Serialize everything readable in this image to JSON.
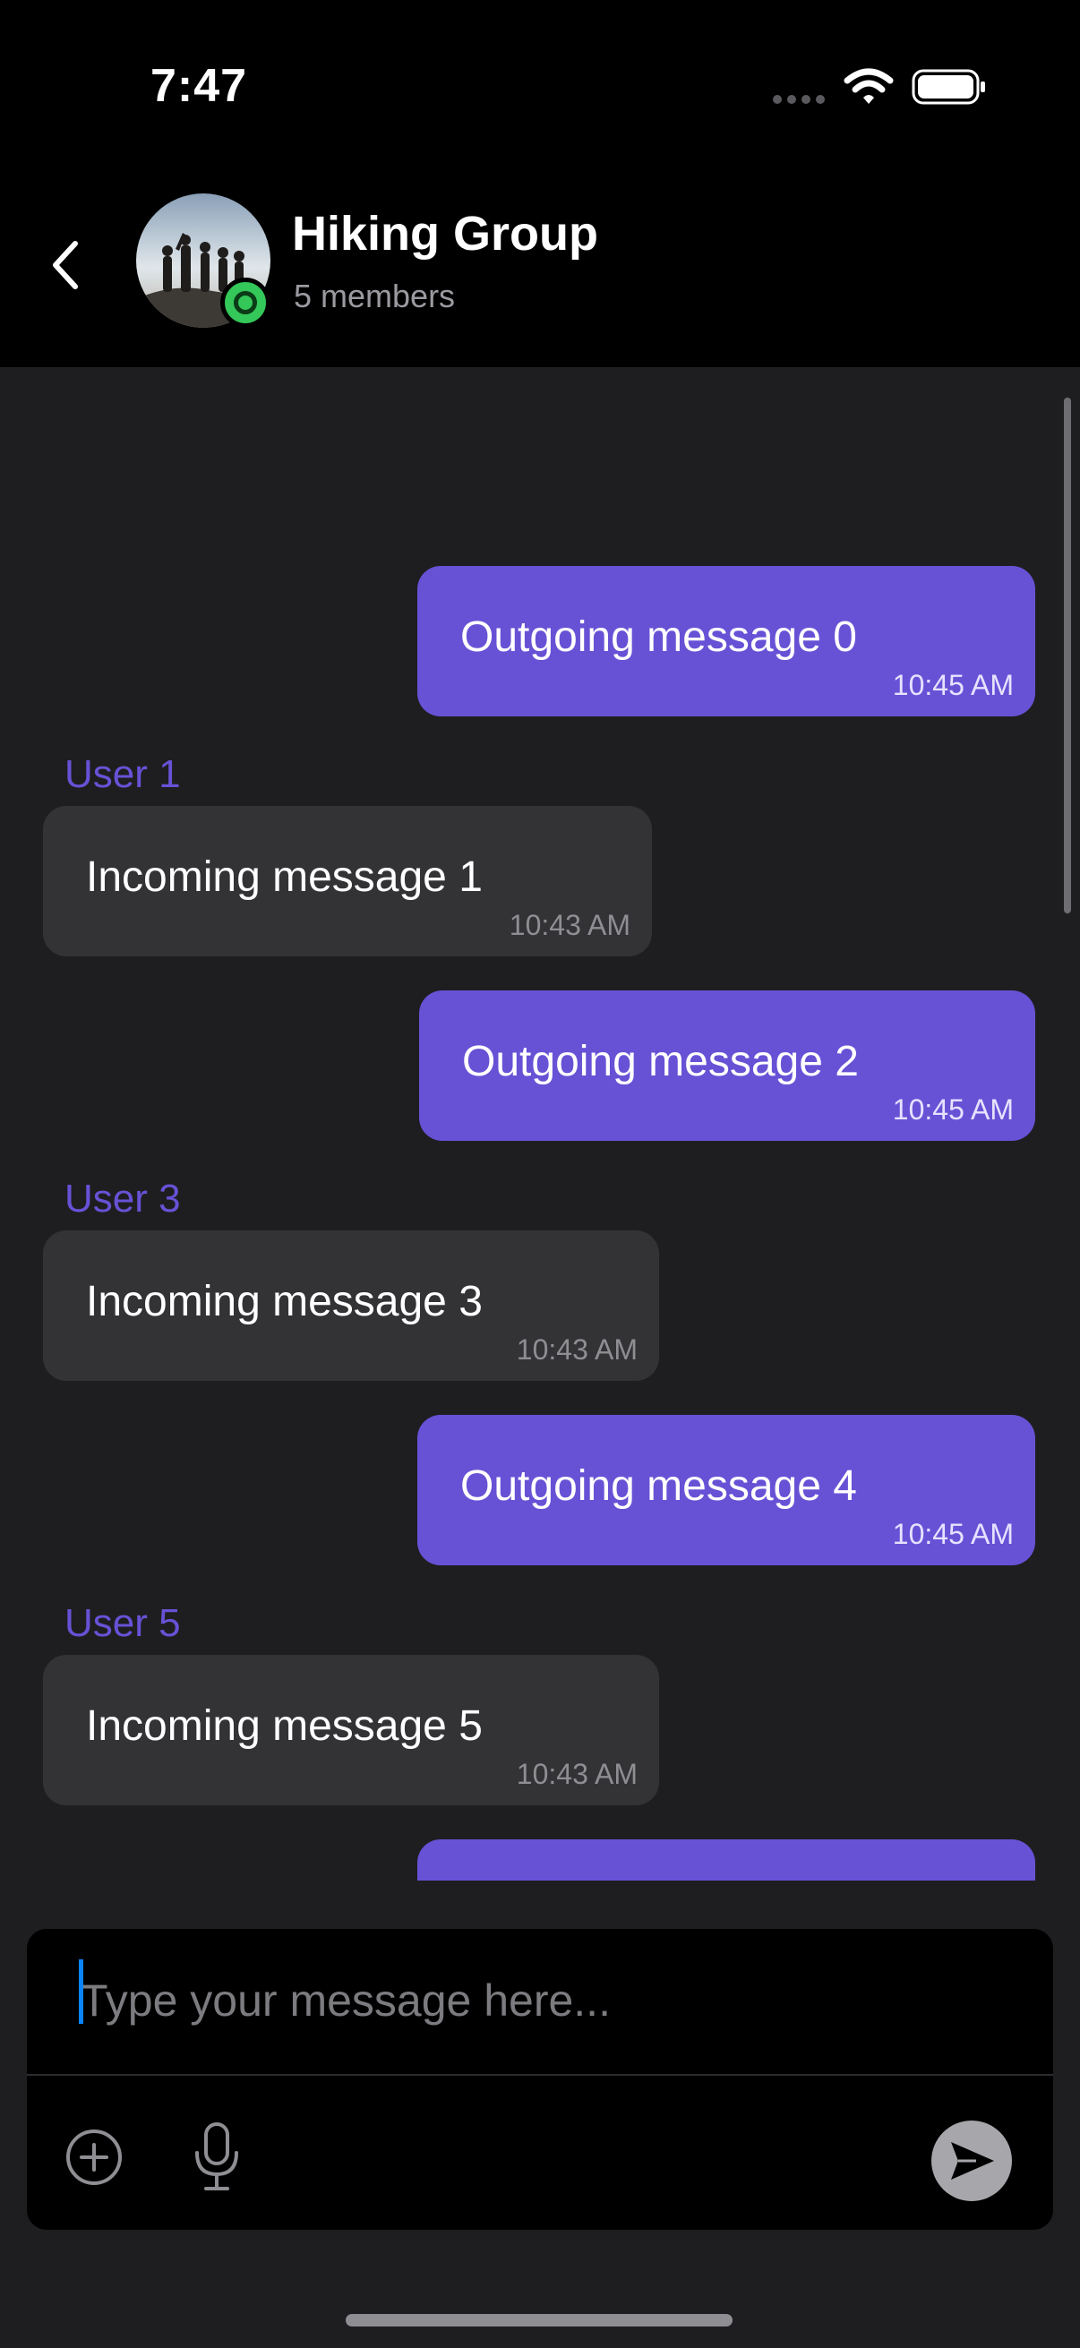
{
  "status_bar": {
    "time": "7:47"
  },
  "header": {
    "back_icon": "chevron-left-icon",
    "title": "Hiking Group",
    "subtitle": "5 members",
    "online_color": "#34c759"
  },
  "messages": [
    {
      "direction": "outgoing",
      "text": "Outgoing message 0",
      "time": "10:45 AM"
    },
    {
      "direction": "incoming",
      "sender": "User 1",
      "text": "Incoming message 1",
      "time": "10:43 AM"
    },
    {
      "direction": "outgoing",
      "text": "Outgoing message 2",
      "time": "10:45 AM"
    },
    {
      "direction": "incoming",
      "sender": "User 3",
      "text": "Incoming message 3",
      "time": "10:43 AM"
    },
    {
      "direction": "outgoing",
      "text": "Outgoing message 4",
      "time": "10:45 AM"
    },
    {
      "direction": "incoming",
      "sender": "User 5",
      "text": "Incoming message 5",
      "time": "10:43 AM"
    }
  ],
  "composer": {
    "placeholder": "Type your message here...",
    "add_icon": "plus-circle-icon",
    "mic_icon": "microphone-icon",
    "send_icon": "send-icon"
  },
  "colors": {
    "accent": "#6752d6",
    "incoming_bubble": "#333336",
    "background": "#1e1e20"
  }
}
